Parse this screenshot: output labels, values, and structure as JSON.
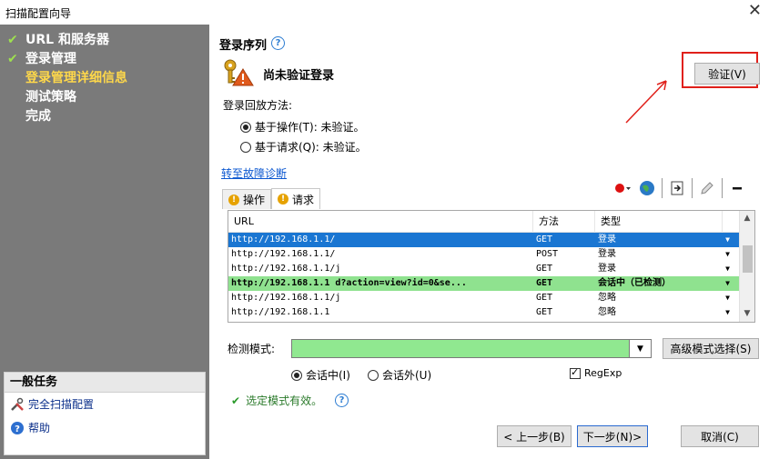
{
  "window": {
    "title": "扫描配置向导",
    "close_glyph": "✕"
  },
  "steps": [
    {
      "label": "URL 和服务器",
      "done": true
    },
    {
      "label": "登录管理",
      "done": true
    },
    {
      "label": "登录管理详细信息",
      "done": false,
      "active": true
    },
    {
      "label": "测试策略",
      "done": false
    },
    {
      "label": "完成",
      "done": false
    }
  ],
  "tasks": {
    "header": "一般任务",
    "items": [
      {
        "label": "完全扫描配置",
        "icon": "tools-icon"
      },
      {
        "label": "帮助",
        "icon": "help-icon"
      }
    ]
  },
  "login": {
    "section_title": "登录序列",
    "help_glyph": "?",
    "status": "尚未验证登录",
    "verify_button": "验证(V)",
    "playback_label": "登录回放方法:",
    "options": [
      {
        "label": "基于操作(T): 未验证。",
        "selected": true
      },
      {
        "label": "基于请求(Q): 未验证。",
        "selected": false
      }
    ],
    "diagnostic_link": "转至故障诊断"
  },
  "tabs": [
    {
      "label": "操作",
      "active": false
    },
    {
      "label": "请求",
      "active": true
    }
  ],
  "grid": {
    "columns": [
      "URL",
      "方法",
      "类型"
    ],
    "rows": [
      {
        "url": "http://192.168.1.1/",
        "method": "GET",
        "type": "登录",
        "style": "sel"
      },
      {
        "url": "http://192.168.1.1/",
        "method": "POST",
        "type": "登录",
        "style": ""
      },
      {
        "url": "http://192.168.1.1/j",
        "method": "GET",
        "type": "登录",
        "style": ""
      },
      {
        "url": "http://192.168.1.1   d?action=view?id=0&se...",
        "method": "GET",
        "type": "会话中（已检测）",
        "style": "hl"
      },
      {
        "url": "http://192.168.1.1/j",
        "method": "GET",
        "type": "忽略",
        "style": ""
      },
      {
        "url": "http://192.168.1.1",
        "method": "GET",
        "type": "忽略",
        "style": ""
      }
    ]
  },
  "detection": {
    "label": "检测模式:",
    "value": "",
    "advanced_button": "高级模式选择(S)",
    "in_session": "会话中(I)",
    "out_session": "会话外(U)",
    "in_session_selected": true,
    "regexp_label": "RegExp",
    "regexp_checked": true,
    "valid_message": "选定模式有效。"
  },
  "nav": {
    "back": "< 上一步(B)",
    "next": "下一步(N)>",
    "cancel": "取消(C)"
  },
  "colors": {
    "sidebar_bg": "#7a7a7a",
    "active_step": "#ffd84a",
    "highlight_row": "#8fe28f",
    "selected_row": "#1a76d2",
    "annotation_red": "#e0201a"
  }
}
